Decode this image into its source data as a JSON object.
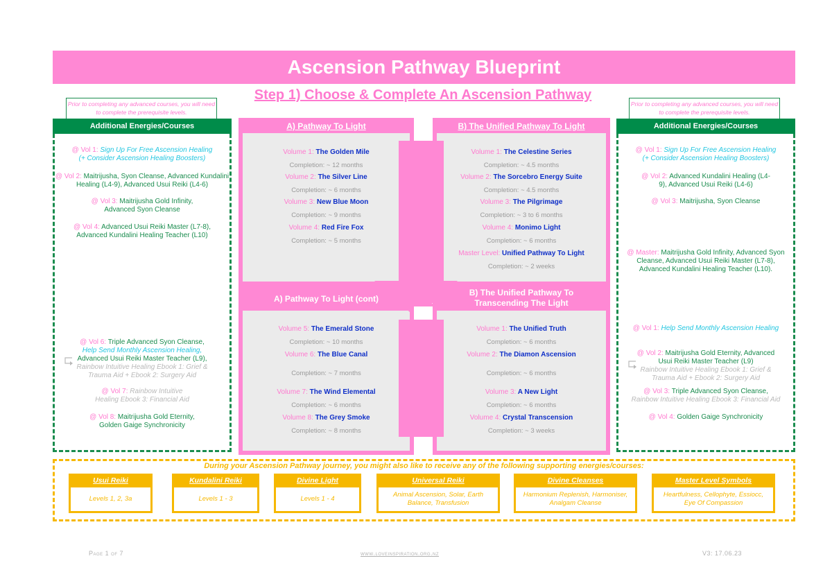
{
  "header": {
    "title": "Ascension Pathway Blueprint",
    "step_title": "Step 1) Choose & Complete An Ascension Pathway"
  },
  "colors": {
    "pink": "#ff88d4",
    "green": "#008c4a",
    "blue": "#1030c8",
    "yellow": "#f6b800",
    "cyan": "#22c6e0",
    "panel_grey": "#ebebeb"
  },
  "left_panel": {
    "prereq_note": "Prior to completing any advanced courses, you will need to complete the prerequisite levels.",
    "heading": "Additional Energies/Courses",
    "top_entries": [
      {
        "label": "@ Vol 1:",
        "text": "Sign Up For Free Ascension Healing",
        "extra": "(+ Consider Ascension Healing Boosters)"
      },
      {
        "label": "@ Vol 2:",
        "text": "Maitrijusha, Syon Cleanse, Advanced Kundalini Healing (L4-9), Advanced Usui Reiki (L4-6)"
      },
      {
        "label": "@ Vol 3:",
        "text": "Maitrijusha Gold Infinity, Advanced Syon Cleanse"
      },
      {
        "label": "@ Vol 4:",
        "text": "Advanced Usui Reiki Master (L7-8), Advanced Kundalini Healing Teacher (L10)"
      }
    ],
    "bottom_entries": [
      {
        "label": "@ Vol 6:",
        "text": "Triple Advanced Syon Cleanse,",
        "cyan": "Help Send Monthly Ascension Healing,",
        "text2": "Advanced Usui Reiki Master Teacher (L9),",
        "grey": "Rainbow Intuitive Healing Ebook 1: Grief & Trauma Aid + Ebook 2: Surgery Aid"
      },
      {
        "label": "@ Vol 7:",
        "grey": "Rainbow Intuitive Healing Ebook 3: Financial Aid"
      },
      {
        "label": "@ Vol 8:",
        "text": "Maitrijusha Gold Eternity, Golden Gaige Synchronicity"
      }
    ]
  },
  "right_panel": {
    "prereq_note": "Prior to completing any advanced courses, you will need to complete the prerequisite levels.",
    "heading": "Additional Energies/Courses",
    "top_entries": [
      {
        "label": "@ Vol 1:",
        "text": "Sign Up For Free Ascension Healing",
        "extra": "(+ Consider Ascension Healing Boosters)"
      },
      {
        "label": "@ Vol 2:",
        "text": "Advanced Kundalini Healing (L4-9), Advanced Usui Reiki (L4-6)"
      },
      {
        "label": "@ Vol 3:",
        "text": "Maitrijusha, Syon Cleanse"
      },
      {
        "label": "@ Master:",
        "text": "Maitrijusha Gold Infinity, Advanced Syon Cleanse, Advanced Usui Reiki Master (L7-8), Advanced Kundalini Healing Teacher (L10)."
      }
    ],
    "bottom_entries": [
      {
        "label": "@ Vol 1:",
        "cyan": "Help Send Monthly Ascension Healing"
      },
      {
        "label": "@ Vol 2:",
        "text": "Maitrijusha Gold Eternity, Advanced Usui Reiki Master Teacher (L9)",
        "grey": "Rainbow Intuitive Healing Ebook 1: Grief & Trauma Aid + Ebook 2: Surgery Aid"
      },
      {
        "label": "@ Vol 3:",
        "text": "Triple Advanced Syon Cleanse,",
        "grey": "Rainbow Intuitive Healing Ebook 3: Financial Aid"
      },
      {
        "label": "@ Vol 4:",
        "text": "Golden Gaige Synchronicity"
      }
    ]
  },
  "pathways": {
    "a_top": {
      "heading": "A) Pathway To Light",
      "volumes": [
        {
          "label": "Volume 1:",
          "name": "The Golden Mile",
          "completion": "Completion: ~ 12 months"
        },
        {
          "label": "Volume 2:",
          "name": "The Silver Line",
          "completion": "Completion: ~ 6 months"
        },
        {
          "label": "Volume 3:",
          "name": "New Blue Moon",
          "completion": "Completion: ~ 9 months"
        },
        {
          "label": "Volume 4:",
          "name": "Red Fire Fox",
          "completion": "Completion: ~ 5 months"
        }
      ]
    },
    "b_top": {
      "heading": "B) The Unified Pathway To Light",
      "volumes": [
        {
          "label": "Volume 1:",
          "name": "The Celestine Series",
          "completion": "Completion: ~ 4.5 months"
        },
        {
          "label": "Volume 2:",
          "name": "The Sorcebro Energy Suite",
          "completion": "Completion: ~ 4.5 months"
        },
        {
          "label": "Volume 3:",
          "name": "The Pilgrimage",
          "completion": "Completion: ~ 3 to 6 months"
        },
        {
          "label": "Volume 4:",
          "name": "Monimo Light",
          "completion": "Completion: ~ 6 months"
        },
        {
          "label": "Master Level:",
          "name": "Unified Pathway To Light",
          "completion": "Completion: ~ 2 weeks"
        }
      ]
    },
    "a_bottom": {
      "heading": "A) Pathway To Light (cont)",
      "volumes": [
        {
          "label": "Volume 5:",
          "name": "The Emerald Stone",
          "completion": "Completion: ~ 10 months"
        },
        {
          "label": "Volume 6:",
          "name": "The Blue Canal",
          "completion": "Completion: ~ 7 months"
        },
        {
          "label": "Volume 7:",
          "name": "The Wind Elemental",
          "completion": "Completion: ~ 6 months"
        },
        {
          "label": "Volume 8:",
          "name": "The Grey Smoke",
          "completion": "Completion: ~ 8 months"
        }
      ]
    },
    "b_bottom": {
      "heading_line1": "B) The Unified Pathway To",
      "heading_line2": "Transcending The Light",
      "volumes": [
        {
          "label": "Volume 1:",
          "name": "The Unified Truth",
          "completion": "Completion: ~ 6 months"
        },
        {
          "label": "Volume 2:",
          "name": "The Diamon Ascension",
          "completion": "Completion: ~ 6 months"
        },
        {
          "label": "Volume 3:",
          "name": "A New Light",
          "completion": "Completion: ~ 6 months"
        },
        {
          "label": "Volume 4:",
          "name": "Crystal Transcension",
          "completion": "Completion: ~ 3 weeks"
        }
      ]
    }
  },
  "supporting": {
    "title": "During your Ascension Pathway journey, you might also like to receive any of the following supporting energies/courses:",
    "courses": [
      {
        "name": "Usui Reiki",
        "detail": "Levels 1, 2, 3a"
      },
      {
        "name": "Kundalini Reiki",
        "detail": "Levels 1 - 3"
      },
      {
        "name": "Divine Light",
        "detail": "Levels 1 - 4"
      },
      {
        "name": "Universal Reiki",
        "detail": "Animal Ascension, Solar, Earth Balance, Transfusion"
      },
      {
        "name": "Divine Cleanses",
        "detail": "Harmonium Replenish, Harmoniser, Analgam Cleanse"
      },
      {
        "name": "Master Level Symbols",
        "detail": "Heartfulness, Cellophyte, Essiocc, Eye Of Compassion"
      }
    ]
  },
  "footer": {
    "page": "Page 1 of 7",
    "website": "www.loveinspiration.org.nz",
    "version": "V3: 17.06.23"
  }
}
